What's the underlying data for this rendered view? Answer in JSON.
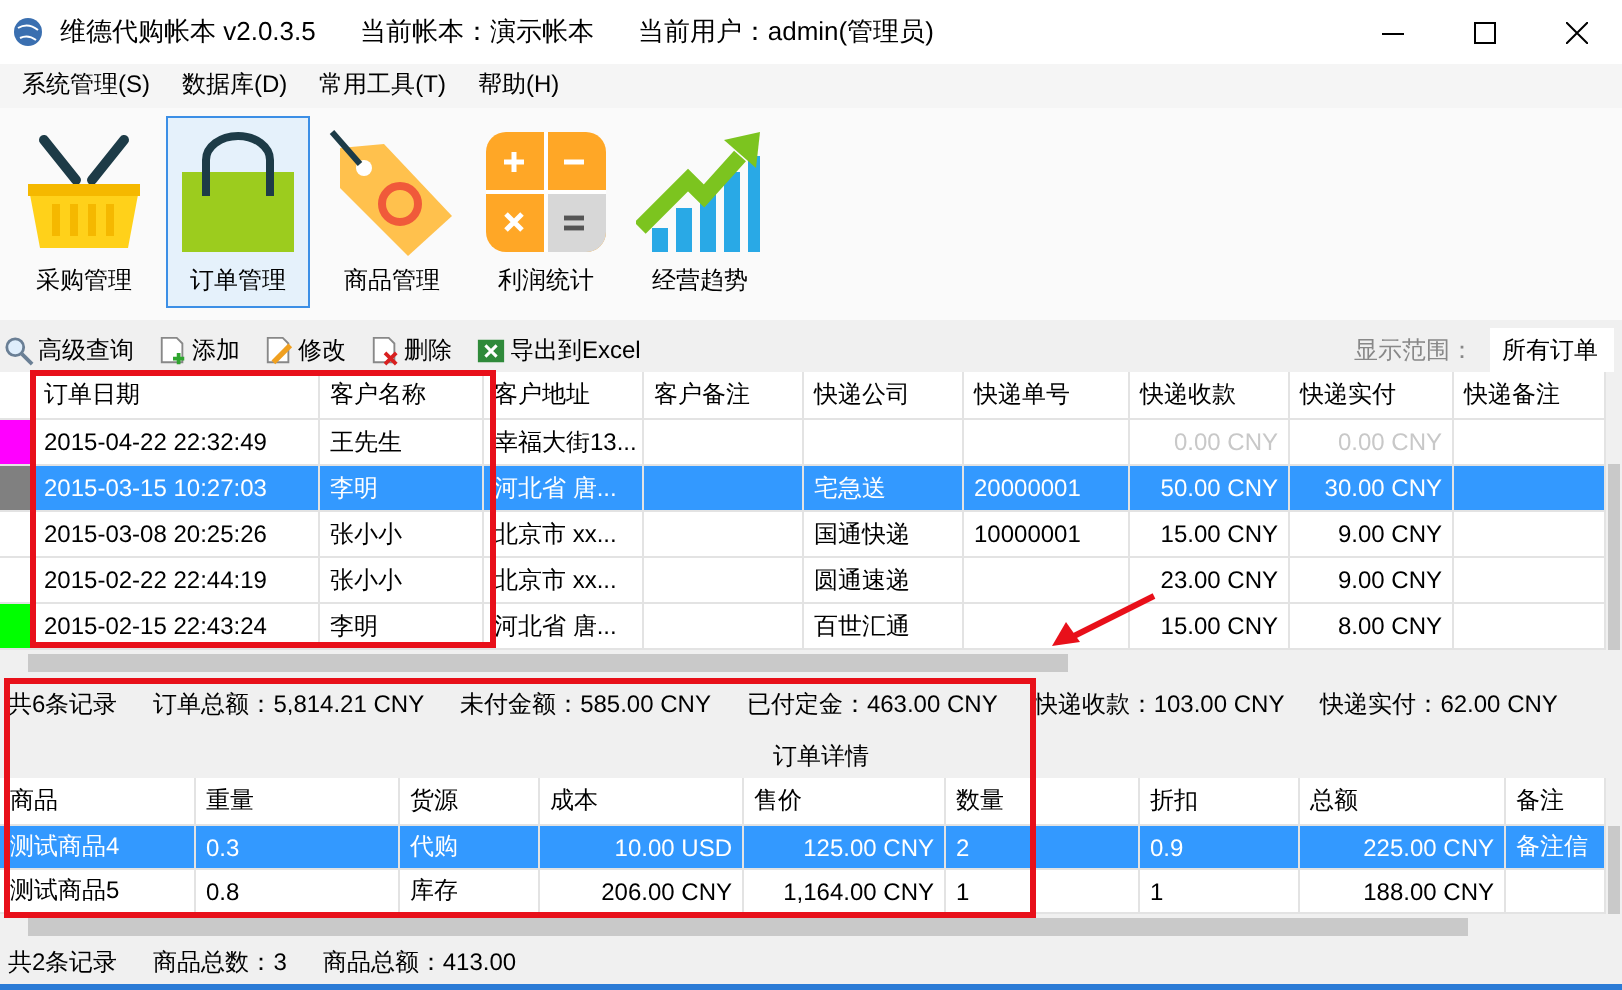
{
  "window": {
    "title": "维德代购帐本  v2.0.3.5",
    "account": "当前帐本：演示帐本",
    "user": "当前用户：admin(管理员)"
  },
  "menu": [
    "系统管理(S)",
    "数据库(D)",
    "常用工具(T)",
    "帮助(H)"
  ],
  "modules": [
    {
      "label": "采购管理",
      "kind": "basket",
      "selected": false
    },
    {
      "label": "订单管理",
      "kind": "bag",
      "selected": true
    },
    {
      "label": "商品管理",
      "kind": "tag",
      "selected": false
    },
    {
      "label": "利润统计",
      "kind": "calculator",
      "selected": false
    },
    {
      "label": "经营趋势",
      "kind": "chart",
      "selected": false
    }
  ],
  "actions": [
    {
      "label": "高级查询",
      "kind": "search"
    },
    {
      "label": "添加",
      "kind": "add"
    },
    {
      "label": "修改",
      "kind": "edit"
    },
    {
      "label": "删除",
      "kind": "delete"
    },
    {
      "label": "导出到Excel",
      "kind": "excel"
    }
  ],
  "range": {
    "label": "显示范围：",
    "value": "所有订单"
  },
  "orders": {
    "columns": [
      "订单日期",
      "客户名称",
      "客户地址",
      "客户备注",
      "快递公司",
      "快递单号",
      "快递收款",
      "快递实付",
      "快递备注"
    ],
    "rows": [
      {
        "color": "#ff00ff",
        "selected": false,
        "faded": true,
        "cells": [
          "2015-04-22 22:32:49",
          "王先生",
          "幸福大街13...",
          null,
          null,
          null,
          "0.00 CNY",
          "0.00 CNY",
          null
        ]
      },
      {
        "color": "#808080",
        "selected": true,
        "faded": false,
        "cells": [
          "2015-03-15 10:27:03",
          "李明",
          "河北省 唐...",
          null,
          "宅急送",
          "20000001",
          "50.00 CNY",
          "30.00 CNY",
          null
        ]
      },
      {
        "selected": false,
        "faded": false,
        "cells": [
          "2015-03-08 20:25:26",
          "张小小",
          "北京市 xx...",
          null,
          "国通快递",
          "10000001",
          "15.00 CNY",
          "9.00 CNY",
          null
        ]
      },
      {
        "selected": false,
        "faded": false,
        "cells": [
          "2015-02-22 22:44:19",
          "张小小",
          "北京市 xx...",
          null,
          "圆通速递",
          null,
          "23.00 CNY",
          "9.00 CNY",
          null
        ]
      },
      {
        "color": "#00ff00",
        "selected": false,
        "faded": false,
        "cells": [
          "2015-02-15 22:43:24",
          "李明",
          "河北省 唐...",
          null,
          "百世汇通",
          null,
          "15.00 CNY",
          "8.00 CNY",
          null
        ]
      }
    ]
  },
  "summary": [
    "共6条记录",
    "订单总额：5,814.21 CNY",
    "未付金额：585.00 CNY",
    "已付定金：463.00 CNY",
    "快递收款：103.00 CNY",
    "快递实付：62.00 CNY"
  ],
  "details": {
    "title": "订单详情",
    "columns": [
      "商品",
      "重量",
      "货源",
      "成本",
      "售价",
      "数量",
      "折扣",
      "总额",
      "备注"
    ],
    "rows": [
      {
        "selected": true,
        "cells": [
          "测试商品4",
          "0.3",
          "代购",
          "10.00 USD",
          "125.00 CNY",
          "2",
          "0.9",
          "225.00 CNY",
          "备注信"
        ]
      },
      {
        "selected": false,
        "cells": [
          "测试商品5",
          "0.8",
          "库存",
          "206.00 CNY",
          "1,164.00 CNY",
          "1",
          "1",
          "188.00 CNY",
          null
        ]
      }
    ]
  },
  "status": [
    "共2条记录",
    "商品总数：3",
    "商品总额：413.00"
  ]
}
